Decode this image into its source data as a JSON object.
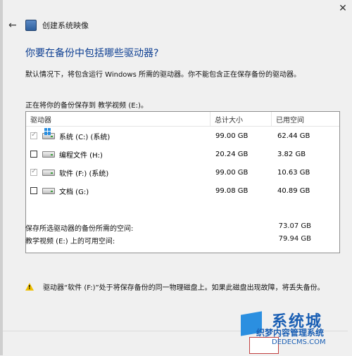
{
  "window": {
    "title": "创建系统映像"
  },
  "page": {
    "heading": "你要在备份中包括哪些驱动器?",
    "description": "默认情况下，将包含运行 Windows 所需的驱动器。你不能包含正在保存备份的驱动器。",
    "save_location": "正在将你的备份保存到 教学视频 (E:)。"
  },
  "table": {
    "headers": [
      "驱动器",
      "总计大小",
      "已用空间"
    ],
    "rows": [
      {
        "name": "系统 (C:) (系统)",
        "total": "99.00 GB",
        "used": "62.44 GB",
        "checked": true,
        "disabled": true
      },
      {
        "name": "编程文件 (H:)",
        "total": "20.24 GB",
        "used": "3.82 GB",
        "checked": false,
        "disabled": false
      },
      {
        "name": "软件 (F:) (系统)",
        "total": "99.00 GB",
        "used": "10.63 GB",
        "checked": true,
        "disabled": true
      },
      {
        "name": "文档 (G:)",
        "total": "99.08 GB",
        "used": "40.89 GB",
        "checked": false,
        "disabled": false
      }
    ]
  },
  "summary": {
    "required_label": "保存所选驱动器的备份所需的空间:",
    "required_value": "73.07 GB",
    "available_label": "教学视频 (E:) 上的可用空间:",
    "available_value": "79.94 GB"
  },
  "warning": {
    "text": "驱动器“软件 (F:)”处于将保存备份的同一物理磁盘上。如果此磁盘出现故障，将丢失备份。"
  },
  "watermark": {
    "line1": "系统城",
    "line2": "织梦内容管理系统",
    "line3": "DEDECMS.COM"
  }
}
